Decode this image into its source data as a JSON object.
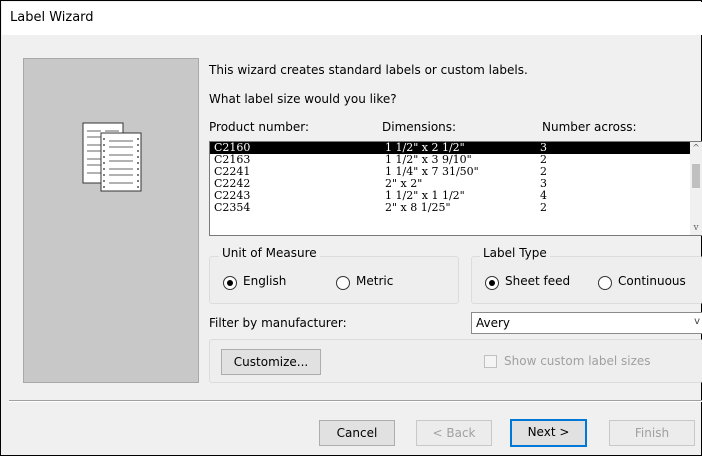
{
  "window": {
    "title": "Label Wizard"
  },
  "intro": {
    "line1": "This wizard creates standard labels or custom labels.",
    "question": "What label size would you like?"
  },
  "table": {
    "headers": [
      "Product number:",
      "Dimensions:",
      "Number across:"
    ],
    "rows": [
      {
        "product": "C2160",
        "dimensions": "1 1/2\" x 2 1/2\"",
        "across": "3",
        "selected": true
      },
      {
        "product": "C2163",
        "dimensions": "1 1/2\" x 3 9/10\"",
        "across": "2"
      },
      {
        "product": "C2241",
        "dimensions": "1 1/4\" x 7 31/50\"",
        "across": "2"
      },
      {
        "product": "C2242",
        "dimensions": "2\" x 2\"",
        "across": "3"
      },
      {
        "product": "C2243",
        "dimensions": "1 1/2\" x 1 1/2\"",
        "across": "4"
      },
      {
        "product": "C2354",
        "dimensions": "2\" x 8 1/25\"",
        "across": "2"
      }
    ]
  },
  "unit_of_measure": {
    "label": "Unit of Measure",
    "options": [
      "English",
      "Metric"
    ],
    "selected": "English"
  },
  "label_type": {
    "label": "Label Type",
    "options": [
      "Sheet feed",
      "Continuous"
    ],
    "selected": "Sheet feed"
  },
  "filter": {
    "label": "Filter by  manufacturer:",
    "value": "Avery"
  },
  "customize_label": "Customize...",
  "show_custom": {
    "label": "Show custom label sizes",
    "checked": false,
    "enabled": false
  },
  "buttons": {
    "cancel": "Cancel",
    "back": "< Back",
    "next": "Next >",
    "finish": "Finish"
  },
  "icons": [
    "label-sheets-icon",
    "chevron-down-icon",
    "scroll-up-icon",
    "scroll-down-icon"
  ]
}
